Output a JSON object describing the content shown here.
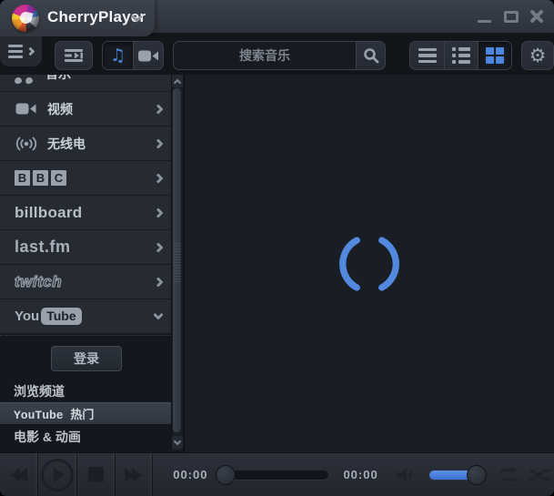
{
  "titlebar": {
    "app_title": "CherryPlayer"
  },
  "toolbar": {
    "search_placeholder": "搜索音乐",
    "settings_glyph": "⚙",
    "music_note_glyph": "♫"
  },
  "sidebar": {
    "items": [
      {
        "label": "音乐",
        "icon": "music-note",
        "expanded": false
      },
      {
        "label": "视频",
        "icon": "video-camera",
        "expanded": false
      },
      {
        "label": "无线电",
        "icon": "radio-waves",
        "expanded": false
      },
      {
        "label": "BBC",
        "icon": "bbc-logo",
        "expanded": false
      },
      {
        "label": "billboard",
        "icon": "billboard-logo",
        "expanded": false
      },
      {
        "label": "last.fm",
        "icon": "lastfm-logo",
        "expanded": false
      },
      {
        "label": "twitch",
        "icon": "twitch-logo",
        "expanded": false
      },
      {
        "label": "YouTube",
        "icon": "youtube-logo",
        "expanded": true
      }
    ],
    "bbc_letters": [
      "B",
      "B",
      "C"
    ],
    "youtube_logo": {
      "part1": "You",
      "part2": "Tube"
    },
    "youtube_submenu": {
      "login_button": "登录",
      "items": [
        {
          "label": "浏览频道",
          "selected": false
        },
        {
          "label": "YouTube 热门",
          "selected": true
        },
        {
          "label": "电影 & 动画",
          "selected": false
        }
      ]
    }
  },
  "player": {
    "elapsed": "00:00",
    "duration": "00:00",
    "progress_percent": 0,
    "volume_percent": 95,
    "loading": true
  },
  "icons": {
    "app_menu_chevron": "chevron-down",
    "hamburger": "three-lines",
    "minimize": "dash",
    "maximize": "square-outline",
    "close": "x-cross",
    "playlist": "lines-with-play-arrow",
    "music_mode": "music-note",
    "video_mode": "video-camera",
    "search": "magnifier",
    "view_list": "three-bars",
    "view_detail": "bars-with-bullets",
    "view_grid": "four-squares",
    "settings": "gear",
    "loading_spinner": "broken-circle-arcs",
    "rewind": "double-triangle-left",
    "play": "triangle-in-circle",
    "stop": "square",
    "forward": "double-triangle-right",
    "volume": "speaker-with-wave",
    "repeat": "loop-arrows",
    "shuffle": "crossed-arrows"
  },
  "colors": {
    "accent_blue": "#4d86e0",
    "spinner_blue": "#5288de",
    "titlebar_bg": "#31363f",
    "panel_bg": "#262b33",
    "dark_bg": "#14171d",
    "main_bg": "#191d24"
  }
}
